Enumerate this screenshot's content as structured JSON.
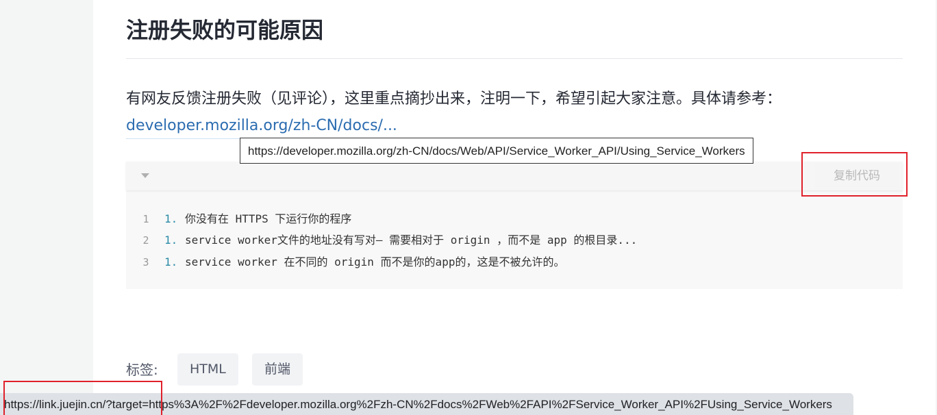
{
  "article": {
    "heading": "注册失败的可能原因",
    "paragraph": "有网友反馈注册失败（见评论），这里重点摘抄出来，注明一下，希望引起大家注意。具体请参考：",
    "link_text": "developer.mozilla.org/zh-CN/docs/...",
    "link_tooltip": "https://developer.mozilla.org/zh-CN/docs/Web/API/Service_Worker_API/Using_Service_Workers"
  },
  "code_block": {
    "copy_label": "复制代码",
    "collapse_icon": "caret-down-icon",
    "lines": [
      {
        "number": "1",
        "marker": "1.",
        "text": "你没有在 HTTPS 下运行你的程序"
      },
      {
        "number": "2",
        "marker": "1.",
        "text": "service worker文件的地址没有写对— 需要相对于 origin ，而不是 app 的根目录..."
      },
      {
        "number": "3",
        "marker": "1.",
        "text": "service worker 在不同的 origin 而不是你的app的，这是不被允许的。"
      }
    ]
  },
  "tags": {
    "label": "标签:",
    "items": [
      "HTML",
      "前端"
    ]
  },
  "status_bar": {
    "url": "https://link.juejin.cn/?target=https%3A%2F%2Fdeveloper.mozilla.org%2Fzh-CN%2Fdocs%2FWeb%2FAPI%2FService_Worker_API%2FUsing_Service_Workers"
  },
  "colors": {
    "link": "#2b6cb0",
    "highlight_box": "#e0202a",
    "code_background": "#f8f8f8"
  }
}
